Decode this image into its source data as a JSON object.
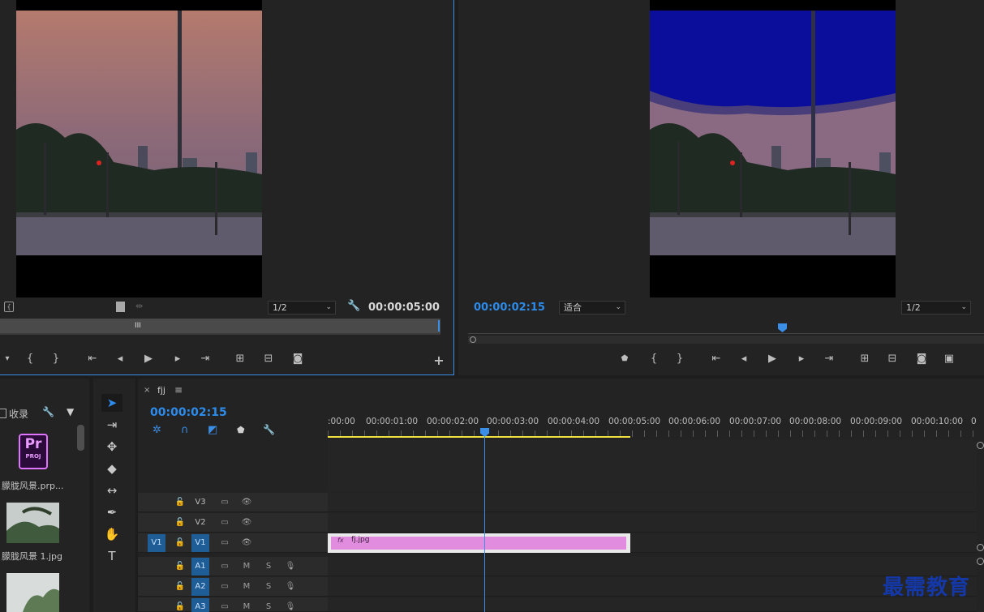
{
  "source_monitor": {
    "zoom": "1/2",
    "duration": "00:00:05:00"
  },
  "program_monitor": {
    "timecode": "00:00:02:15",
    "fit": "适合",
    "zoom": "1/2"
  },
  "project": {
    "bin_label": "收录",
    "items": [
      {
        "name": "朦胧风景.prp...",
        "badge": "Pr",
        "badge_sub": "PROJ"
      },
      {
        "name": "朦胧风景 1.jpg"
      },
      {
        "name": ""
      }
    ]
  },
  "timeline": {
    "sequence_name": "fjj",
    "timecode": "00:00:02:15",
    "ruler_labels": [
      ":00:00",
      "00:00:01:00",
      "00:00:02:00",
      "00:00:03:00",
      "00:00:04:00",
      "00:00:05:00",
      "00:00:06:00",
      "00:00:07:00",
      "00:00:08:00",
      "00:00:09:00",
      "00:00:10:00",
      "0"
    ],
    "video_tracks": [
      {
        "name": "V3"
      },
      {
        "name": "V2"
      },
      {
        "name": "V1",
        "source": "V1"
      }
    ],
    "audio_tracks": [
      {
        "name": "A1",
        "m": "M",
        "s": "S"
      },
      {
        "name": "A2",
        "m": "M",
        "s": "S"
      },
      {
        "name": "A3",
        "m": "M",
        "s": "S"
      }
    ],
    "clip": {
      "label": "fj.jpg",
      "fx": "fx",
      "color": "#e28ce0"
    }
  },
  "watermark": "最需教育"
}
